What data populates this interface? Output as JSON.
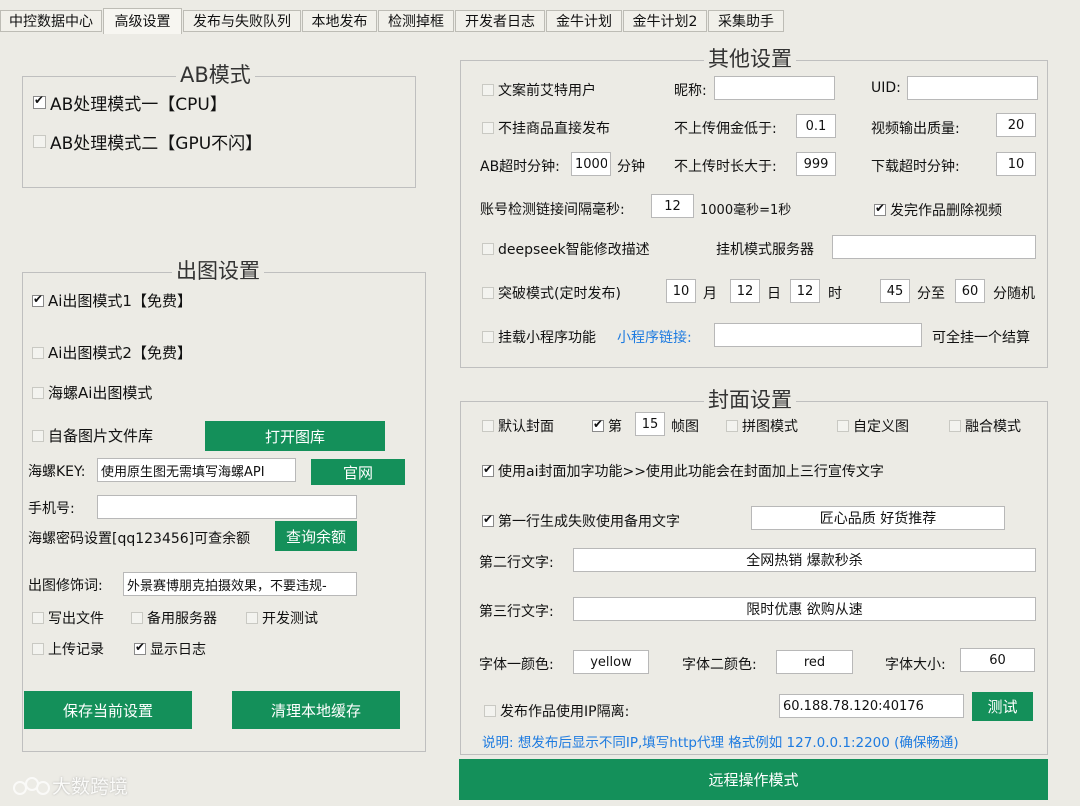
{
  "tabs": [
    "中控数据中心",
    "高级设置",
    "发布与失败队列",
    "本地发布",
    "检测掉框",
    "开发者日志",
    "金牛计划",
    "金牛计划2",
    "采集助手"
  ],
  "ab": {
    "title": "AB模式",
    "mode1": "AB处理模式一【CPU】",
    "mode2": "AB处理模式二【GPU不闪】"
  },
  "chutu": {
    "title": "出图设置",
    "mode1": "Ai出图模式1【免费】",
    "mode2": "Ai出图模式2【免费】",
    "hailuo": "海螺Ai出图模式",
    "self_lib": "自备图片文件库",
    "open_lib_btn": "打开图库",
    "key_label": "海螺KEY:",
    "key_value": "使用原生图无需填写海螺API",
    "official_btn": "官网",
    "phone_label": "手机号:",
    "phone_value": "",
    "pwd_label": "海螺密码设置[qq123456]可查余额",
    "query_btn": "查询余额",
    "modifier_label": "出图修饰词:",
    "modifier_value": "外景赛博朋克拍摄效果，不要违规-",
    "write_file": "写出文件",
    "backup_server": "备用服务器",
    "dev_test": "开发测试",
    "upload_log": "上传记录",
    "show_log": "显示日志",
    "save_btn": "保存当前设置",
    "clear_btn": "清理本地缓存"
  },
  "other": {
    "title": "其他设置",
    "at_user": "文案前艾特用户",
    "nickname_label": "昵称:",
    "nickname_value": "",
    "uid_label": "UID:",
    "uid_value": "",
    "no_goods": "不挂商品直接发布",
    "min_comm_label": "不上传佣金低于:",
    "min_comm_value": "0.1",
    "quality_label": "视频输出质量:",
    "quality_value": "20",
    "ab_timeout_label": "AB超时分钟:",
    "ab_timeout_value": "1000",
    "ab_timeout_unit": "分钟",
    "max_len_label": "不上传时长大于:",
    "max_len_value": "999",
    "dl_timeout_label": "下载超时分钟:",
    "dl_timeout_value": "10",
    "interval_label": "账号检测链接间隔毫秒:",
    "interval_value": "12",
    "interval_note": "1000毫秒=1秒",
    "delete_video": "发完作品删除视频",
    "deepseek": "deepseek智能修改描述",
    "server_label": "挂机模式服务器",
    "server_value": "",
    "burst": "突破模式(定时发布)",
    "month_value": "10",
    "month_unit": "月",
    "day_value": "12",
    "day_unit": "日",
    "hour_value": "12",
    "hour_unit": "时",
    "min_from": "45",
    "min_to_label": "分至",
    "min_to": "60",
    "random_label": "分随机",
    "mini_prog": "挂载小程序功能",
    "mini_link_label": "小程序链接:",
    "mini_link_value": "",
    "mini_note": "可全挂一个结算"
  },
  "cover": {
    "title": "封面设置",
    "default_cover": "默认封面",
    "frame_prefix": "第",
    "frame_value": "15",
    "frame_suffix": "帧图",
    "collage": "拼图模式",
    "custom": "自定义图",
    "blend": "融合模式",
    "ai_text": "使用ai封面加字功能>>使用此功能会在封面加上三行宣传文字",
    "line1_fallback": "第一行生成失败使用备用文字",
    "line1_value": "匠心品质 好货推荐",
    "line2_label": "第二行文字:",
    "line2_value": "全网热销 爆款秒杀",
    "line3_label": "第三行文字:",
    "line3_value": "限时优惠 欲购从速",
    "font1_label": "字体一颜色:",
    "font1_value": "yellow",
    "font2_label": "字体二颜色:",
    "font2_value": "red",
    "size_label": "字体大小:",
    "size_value": "60",
    "ip_isolate": "发布作品使用IP隔离:",
    "ip_value": "60.188.78.120:40176",
    "test_btn": "测试",
    "note": "说明: 想发布后显示不同IP,填写http代理  格式例如 127.0.0.1:2200 (确保畅通)"
  },
  "remote_btn": "远程操作模式",
  "watermark": "大数跨境",
  "colors": {
    "accent": "#14905a",
    "link": "#1e7be0"
  }
}
